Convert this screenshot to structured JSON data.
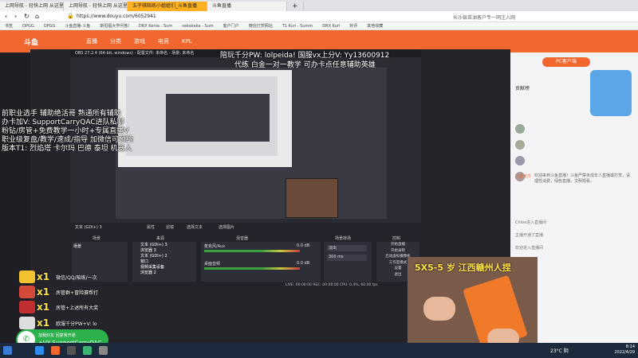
{
  "tabs": [
    {
      "label": "上网导航 - 轻快上网 从这里开始"
    },
    {
      "label": "上网导航 - 轻快上网 从这里开始"
    },
    {
      "label": "五子棋陪练小姐姐们_斗鱼直播"
    },
    {
      "label": "斗鱼直播"
    }
  ],
  "address": {
    "url": "https://www.douyu.com/6052941",
    "search_hint": "长沙县菜油客户专一网注入网"
  },
  "bookmarks": [
    "书签",
    "OPGG",
    "OPGG",
    "斗鱼直播-斗鱼",
    "斯坦福大学问答/",
    "DRX Kenia - Sum",
    "sakakaka - Sum",
    "客户门户",
    "微信打赏网站",
    "T1 Kuri - Summ",
    "DRX Kuri",
    "好评",
    "其他收藏"
  ],
  "site": {
    "logo": "斗鱼",
    "nav": [
      "直播",
      "分类",
      "游戏",
      "电竞",
      "KPL"
    ],
    "pc_client": "PC客户端"
  },
  "obs": {
    "window_title": "OBS 27.2.4 (64-bit, windows) - 配置文件: 未命名 - 场景: 未命名",
    "docks": {
      "scenes": "场景",
      "sources": "来源",
      "mixer": "混音器",
      "transitions": "场景转场",
      "controls": "控制"
    },
    "scene_item": "场景",
    "source_items": [
      "文本 (GDI+) 3",
      "浏览器 3",
      "文本 (GDI+) 2",
      "窗口",
      "视频采集设备",
      "浏览器 2"
    ],
    "mixer_items": [
      "麦克风/Aux",
      "桌面音频"
    ],
    "mixer_db": [
      "0.0 dB",
      "0.0 dB"
    ],
    "transition": "淡出",
    "duration": "300 ms",
    "controls": [
      "开始直播",
      "开始录制",
      "启动虚拟摄像机",
      "工作室模式",
      "设置",
      "退出"
    ],
    "toolbar": [
      "属性",
      "滤镜",
      "选择文本",
      "选择图片"
    ],
    "status": "LIVE: 00:00:00   REC: 00:00:00   CPU: 0.4%, 60.00 fps",
    "selected_source": "文本 (GDI+) 3"
  },
  "overlay": {
    "top_line1": "陪玩千分PW: lolpeida! 国服vx上分V: Yy13600912",
    "top_line2": "代练 白金一对一教学 可办卡点任意辅助英雄",
    "left_lines": [
      "前职业选手 辅助绝活哥 熟通所有辅助",
      "办卡加V: SupportCarryQAC进队私聊",
      "粉钻/房管+免费教学一小时+专属直播V",
      "职业级复盘/教学/速成/指导 加微信可预约",
      "版本T1: 烈焰塔 卡尔玛 巴德 泰坦 机器人"
    ],
    "webcam_label": "5X5-5 岁 江西赣州人捏",
    "gifts": [
      {
        "count": "x1",
        "label": "微信/QQ/陪练/一次",
        "color": "#f2c230"
      },
      {
        "count": "x1",
        "label": "房管群+冒险赛帮打",
        "color": "#d44a3a"
      },
      {
        "count": "x1",
        "label": "房管+上述所有大奖",
        "color": "#c03030"
      },
      {
        "count": "x1",
        "label": "欧服千分PW+V: lo",
        "color": "#dddddd"
      }
    ],
    "wechat": {
      "line1": "加我好友 回复我开通",
      "line2": "+VX SupportCarryQAC"
    }
  },
  "rightpanel": {
    "title": "PC客户端",
    "rank_label": "贡献榜",
    "notice_user": "斗鱼官方",
    "notice": "欢迎来到斗鱼直播！斗鱼严禁未成年人直播或打赏，请理性消费，绿色直播，文明观看。",
    "chat": [
      "Chloe进入直播间",
      "主播开通了直播",
      "欢迎进入直播间"
    ]
  },
  "taskbar": {
    "temp": "23°C 阴",
    "time": "8:14",
    "date": "2022/4/29"
  }
}
